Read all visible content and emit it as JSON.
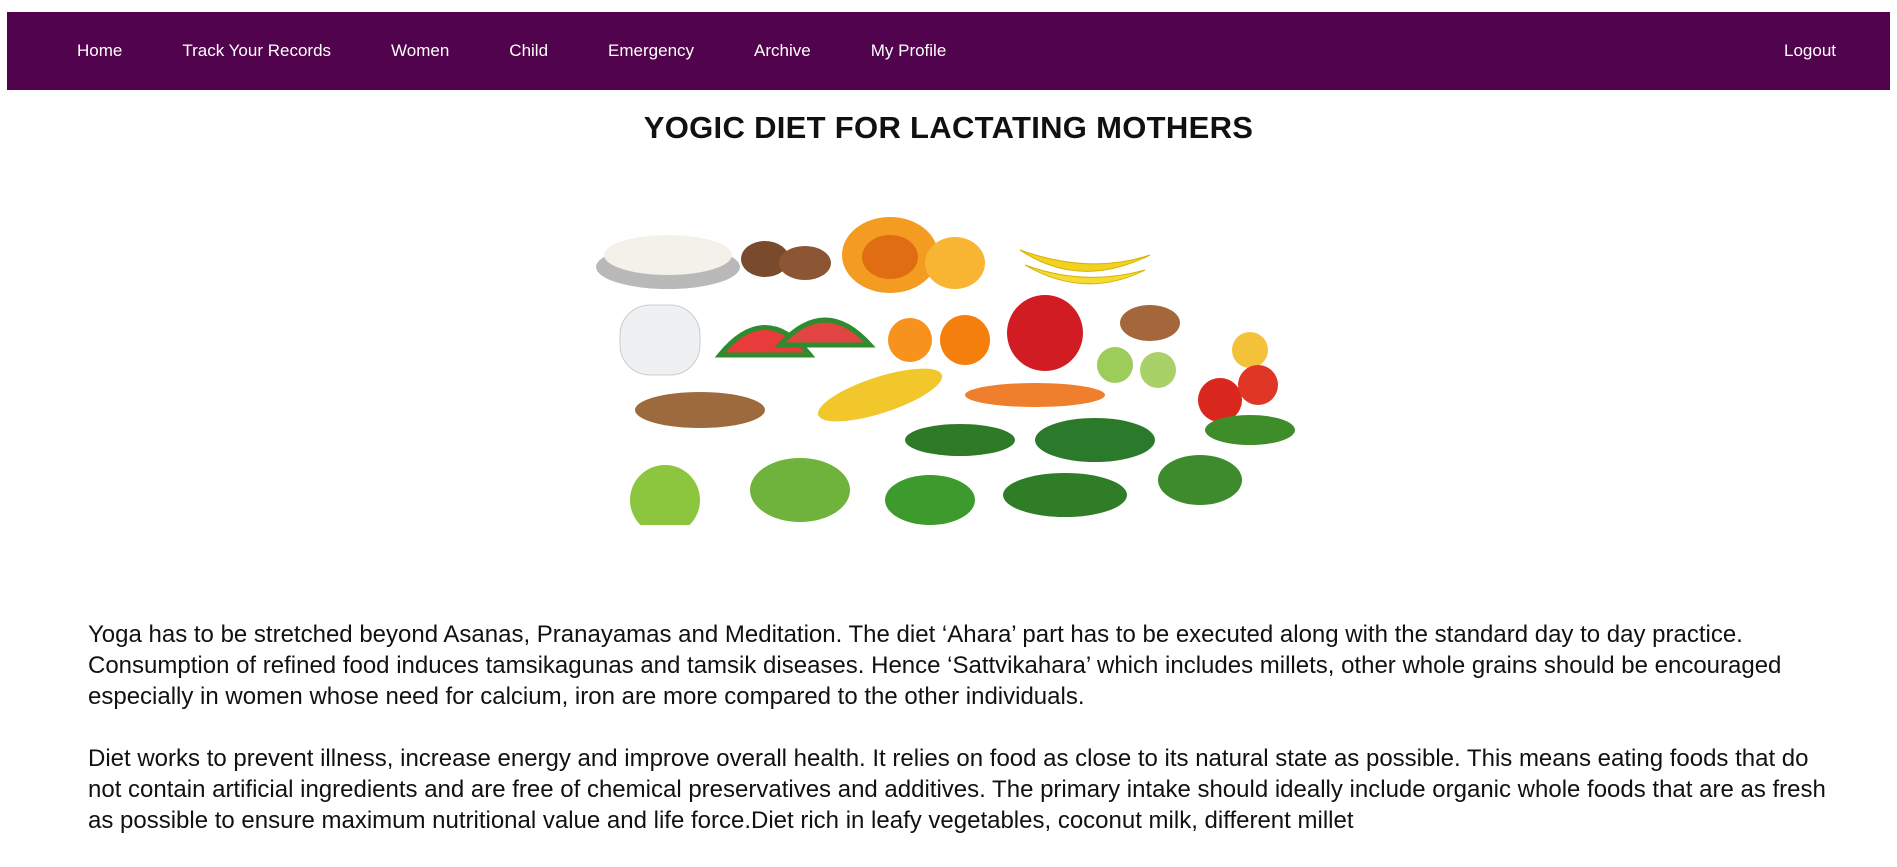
{
  "nav": {
    "items": [
      {
        "label": "Home"
      },
      {
        "label": "Track Your Records"
      },
      {
        "label": "Women"
      },
      {
        "label": "Child"
      },
      {
        "label": "Emergency"
      },
      {
        "label": "Archive"
      },
      {
        "label": "My Profile"
      }
    ],
    "logout": "Logout"
  },
  "colors": {
    "navbar": "#52034d"
  },
  "page": {
    "title": "YOGIC DIET FOR LACTATING MOTHERS",
    "paragraphs": [
      "Yoga has to be stretched beyond Asanas, Pranayamas and Meditation. The diet ‘Ahara’ part has to be executed along with the standard day to day practice. Consumption of refined food induces tamsikagunas and tamsik diseases. Hence ‘Sattvikahara’ which includes millets, other whole grains should be encouraged especially in women whose need for calcium, iron are more compared to the other individuals.",
      "Diet works to prevent illness, increase energy and improve overall health. It relies on food as close to its natural state as possible. This means eating foods that do not contain artificial ingredients and are free of chemical preservatives and additives. The primary intake should ideally include organic whole foods that are as fresh as possible to ensure maximum nutritional value and life force.Diet rich in leafy vegetables, coconut milk, different millet"
    ]
  }
}
